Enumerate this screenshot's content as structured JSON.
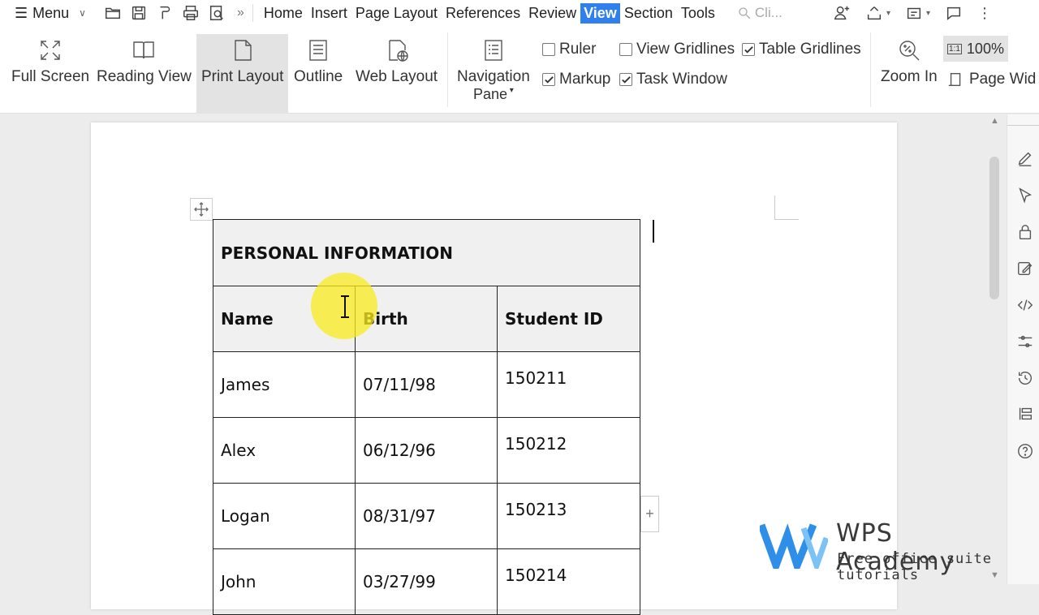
{
  "menubar": {
    "menu_label": "Menu",
    "tabs": [
      "Home",
      "Insert",
      "Page Layout",
      "References",
      "Review",
      "View",
      "Section",
      "Tools"
    ],
    "active_tab": "View",
    "search_placeholder": "Cli..."
  },
  "ribbon": {
    "full_screen": "Full Screen",
    "reading_view": "Reading View",
    "print_layout": "Print Layout",
    "outline": "Outline",
    "web_layout": "Web Layout",
    "navigation_pane_line1": "Navigation",
    "navigation_pane_line2": "Pane",
    "ruler": "Ruler",
    "view_gridlines": "View Gridlines",
    "table_gridlines": "Table Gridlines",
    "markup": "Markup",
    "task_window": "Task Window",
    "zoom_in": "Zoom In",
    "zoom_value": "100%",
    "page_width": "Page Wid",
    "checkboxes": {
      "ruler": false,
      "view_gridlines": false,
      "table_gridlines": true,
      "markup": true,
      "task_window": true
    }
  },
  "document": {
    "table": {
      "title": "PERSONAL INFORMATION",
      "headers": [
        "Name",
        "Birth",
        "Student ID"
      ],
      "rows": [
        [
          "James",
          "07/11/98",
          "150211"
        ],
        [
          "Alex",
          "06/12/96",
          "150212"
        ],
        [
          "Logan",
          "08/31/97",
          "150213"
        ],
        [
          "John",
          "03/27/99",
          "150214"
        ]
      ]
    }
  },
  "watermark": {
    "name": "WPS Academy",
    "tagline": "Free office suite tutorials"
  },
  "colors": {
    "accent": "#2f80ed",
    "highlight": "#faeb1e",
    "logo": "#2f8fe8"
  }
}
